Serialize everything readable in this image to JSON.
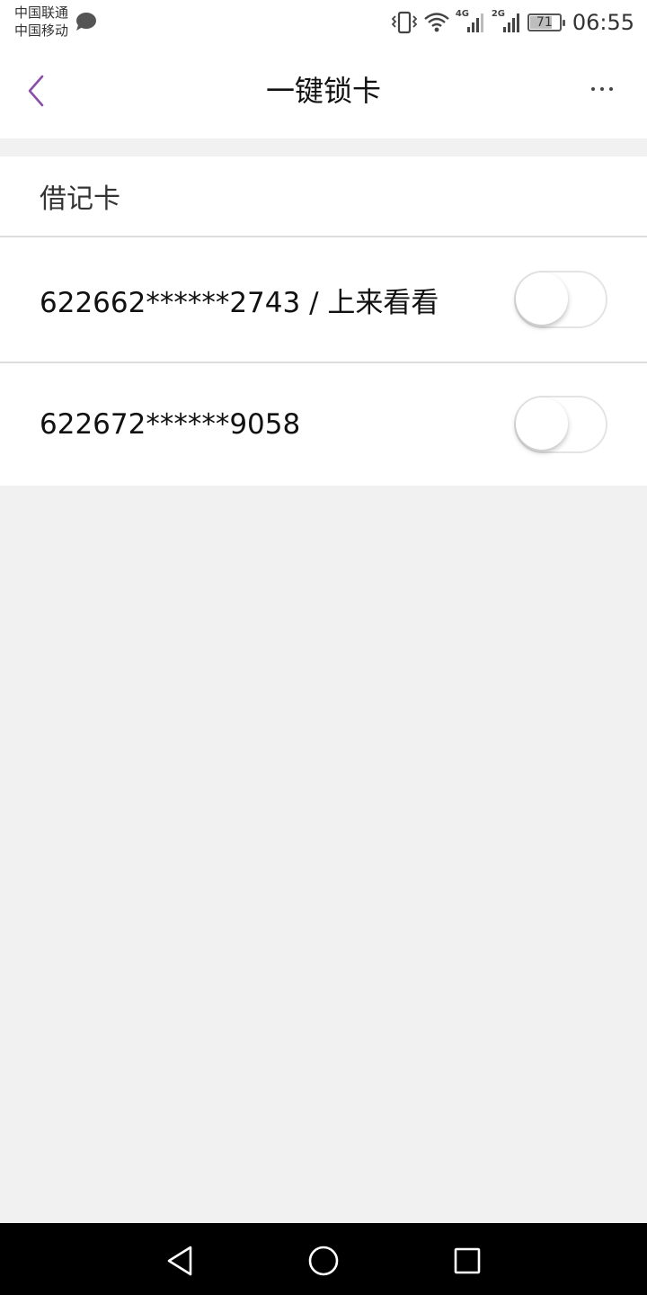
{
  "status_bar": {
    "carrier_1": "中国联通",
    "carrier_2": "中国移动",
    "network_1": "4G",
    "network_2": "2G",
    "battery": "71",
    "time": "06:55",
    "icons": [
      "message-icon",
      "vibrate-icon",
      "wifi-icon",
      "signal-4g-icon",
      "signal-2g-icon",
      "battery-icon"
    ]
  },
  "header": {
    "title": "一键锁卡",
    "back_icon": "back-chevron-icon",
    "more_icon": "more-dots-icon",
    "accent_color": "#8a4ea8"
  },
  "section": {
    "title": "借记卡",
    "cards": [
      {
        "label": "622662******2743 / 上来看看",
        "locked": false
      },
      {
        "label": "622672******9058",
        "locked": false
      }
    ]
  },
  "nav_bar": {
    "icons": [
      "back-triangle-icon",
      "home-circle-icon",
      "recents-square-icon"
    ]
  }
}
